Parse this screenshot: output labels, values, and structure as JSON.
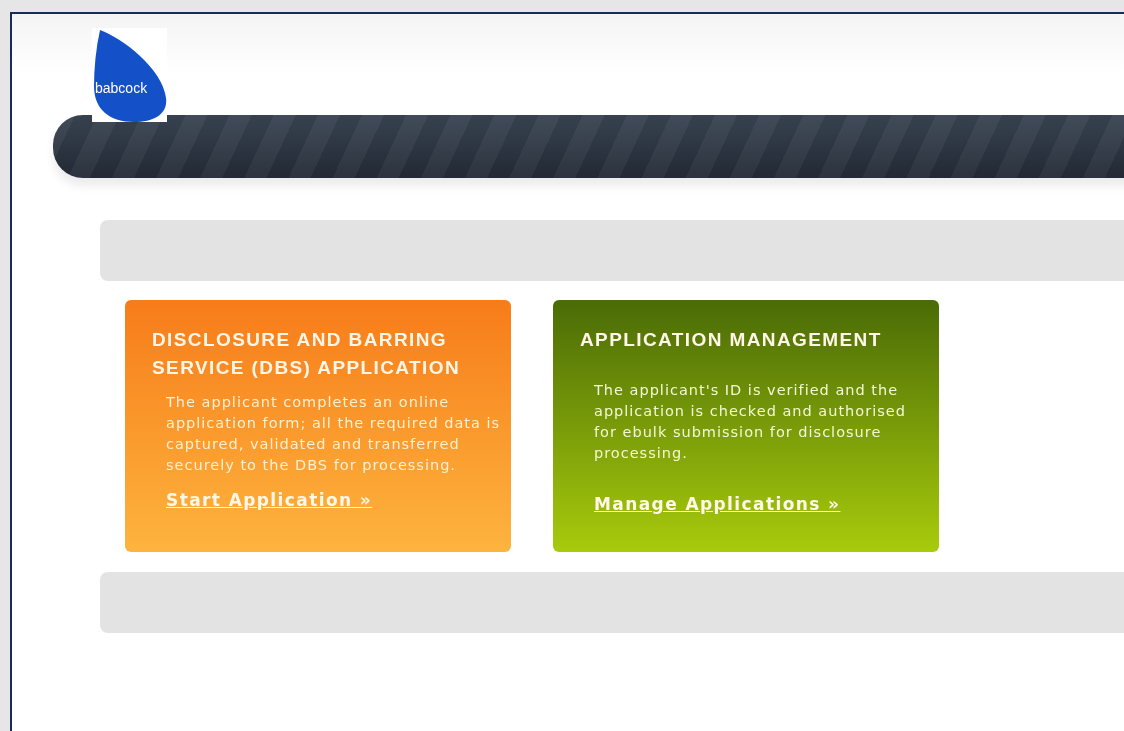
{
  "logo": {
    "text": "babcock"
  },
  "cards": [
    {
      "kind": "apply",
      "title": "DISCLOSURE AND BARRING SERVICE (DBS) APPLICATION",
      "description": "The applicant completes an online application form; all the required data is captured, validated and transferred securely to the DBS for processing.",
      "link": "Start Application »"
    },
    {
      "kind": "manage",
      "title": "APPLICATION MANAGEMENT",
      "description": "The applicant's ID is verified and the application is checked and authorised for ebulk submission for disclosure processing.",
      "link": "Manage Applications »"
    }
  ]
}
